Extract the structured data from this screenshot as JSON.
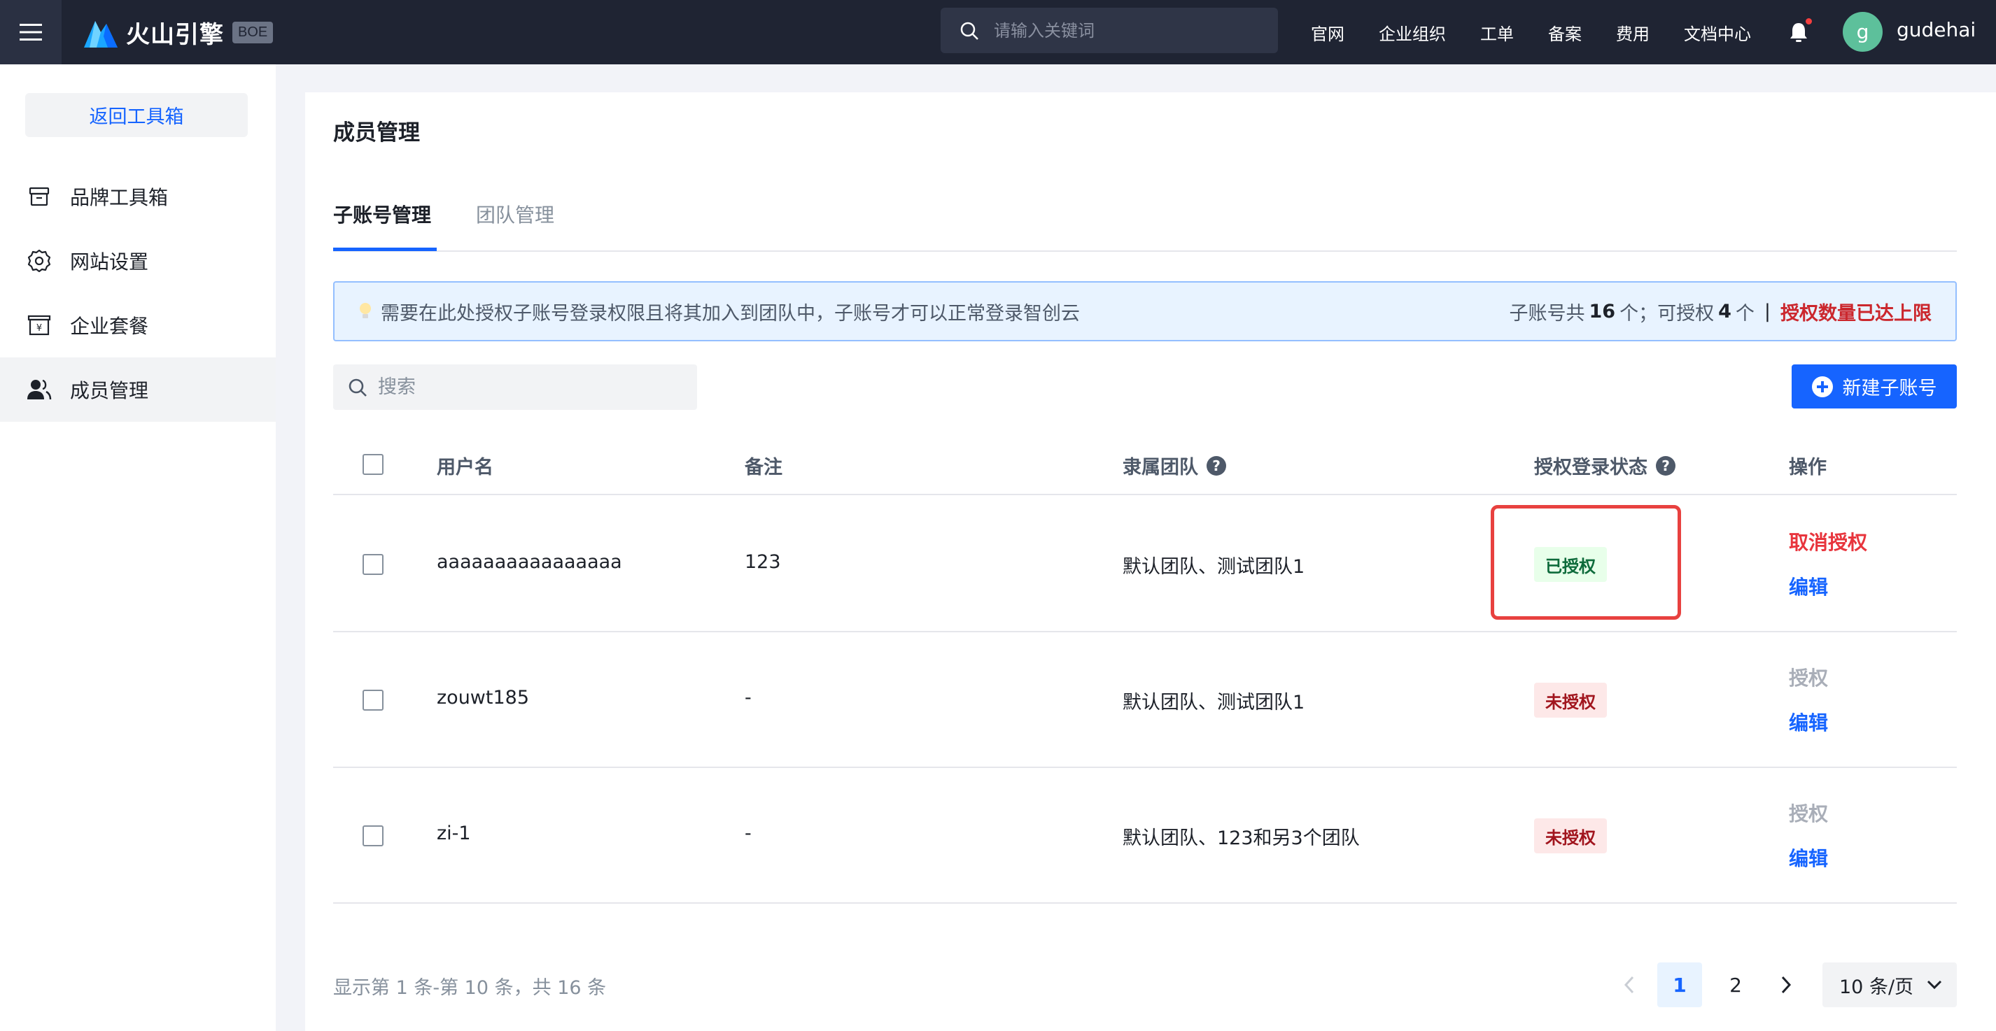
{
  "topbar": {
    "brand": "火山引擎",
    "env_badge": "BOE",
    "search_placeholder": "请输入关键词",
    "nav": [
      "官网",
      "企业组织",
      "工单",
      "备案",
      "费用",
      "文档中心"
    ],
    "avatar_letter": "g",
    "username": "gudehai"
  },
  "sidebar": {
    "back_label": "返回工具箱",
    "items": [
      {
        "label": "品牌工具箱",
        "icon": "box-icon"
      },
      {
        "label": "网站设置",
        "icon": "gear-icon"
      },
      {
        "label": "企业套餐",
        "icon": "package-icon"
      },
      {
        "label": "成员管理",
        "icon": "users-icon",
        "active": true
      }
    ]
  },
  "main": {
    "title": "成员管理",
    "tabs": [
      {
        "label": "子账号管理",
        "active": true
      },
      {
        "label": "团队管理",
        "active": false
      }
    ],
    "alert": {
      "message": "需要在此处授权子账号登录权限且将其加入到团队中，子账号才可以正常登录智创云",
      "total_prefix": "子账号共",
      "total_count": "16",
      "total_suffix": "个；可授权",
      "auth_count": "4",
      "auth_suffix": "个",
      "separator": "|",
      "limit_text": "授权数量已达上限"
    },
    "search_placeholder": "搜索",
    "new_button": "新建子账号",
    "table": {
      "headers": [
        "用户名",
        "备注",
        "隶属团队",
        "授权登录状态",
        "操作"
      ],
      "rows": [
        {
          "username": "aaaaaaaaaaaaaaaa",
          "note": "123",
          "team": "默认团队、测试团队1",
          "status": "已授权",
          "action1": "取消授权",
          "action2": "编辑"
        },
        {
          "username": "zouwt185",
          "note": "-",
          "team": "默认团队、测试团队1",
          "status": "未授权",
          "action1": "授权",
          "action2": "编辑"
        },
        {
          "username": "zi-1",
          "note": "-",
          "team": "默认团队、123和另3个团队",
          "status": "未授权",
          "action1": "授权",
          "action2": "编辑"
        }
      ]
    },
    "footer": {
      "range_text": "显示第 1 条-第 10 条，共 16 条",
      "pages": [
        "1",
        "2"
      ],
      "current_page": "1",
      "page_size": "10 条/页"
    }
  },
  "colors": {
    "accent": "#1664ff",
    "danger": "#e8353d",
    "topbar": "#1f2433"
  }
}
